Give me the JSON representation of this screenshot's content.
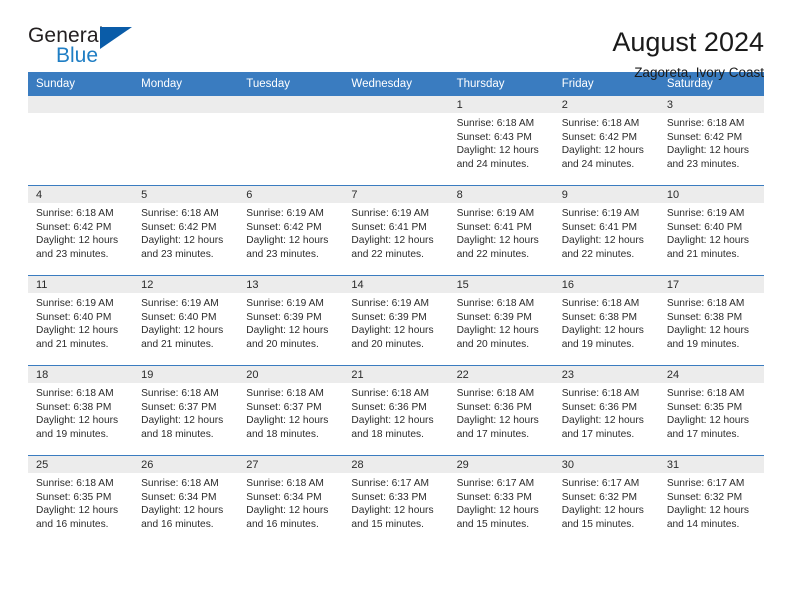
{
  "brand": {
    "line1": "General",
    "line2": "Blue",
    "triangle_color": "#0a5ca8",
    "blue_text_color": "#1f7ec4"
  },
  "header": {
    "title": "August 2024",
    "subtitle": "Zagoreta, Ivory Coast",
    "header_bg_color": "#3a7cc0",
    "daynum_bg_color": "#ececec"
  },
  "weekday_headers": [
    "Sunday",
    "Monday",
    "Tuesday",
    "Wednesday",
    "Thursday",
    "Friday",
    "Saturday"
  ],
  "labels": {
    "sunrise": "Sunrise:",
    "sunset": "Sunset:",
    "daylight": "Daylight:"
  },
  "weeks": [
    [
      {
        "empty": true
      },
      {
        "empty": true
      },
      {
        "empty": true
      },
      {
        "empty": true
      },
      {
        "day": "1",
        "sunrise": "Sunrise: 6:18 AM",
        "sunset": "Sunset: 6:43 PM",
        "daylight1": "Daylight: 12 hours",
        "daylight2": "and 24 minutes."
      },
      {
        "day": "2",
        "sunrise": "Sunrise: 6:18 AM",
        "sunset": "Sunset: 6:42 PM",
        "daylight1": "Daylight: 12 hours",
        "daylight2": "and 24 minutes."
      },
      {
        "day": "3",
        "sunrise": "Sunrise: 6:18 AM",
        "sunset": "Sunset: 6:42 PM",
        "daylight1": "Daylight: 12 hours",
        "daylight2": "and 23 minutes."
      }
    ],
    [
      {
        "day": "4",
        "sunrise": "Sunrise: 6:18 AM",
        "sunset": "Sunset: 6:42 PM",
        "daylight1": "Daylight: 12 hours",
        "daylight2": "and 23 minutes."
      },
      {
        "day": "5",
        "sunrise": "Sunrise: 6:18 AM",
        "sunset": "Sunset: 6:42 PM",
        "daylight1": "Daylight: 12 hours",
        "daylight2": "and 23 minutes."
      },
      {
        "day": "6",
        "sunrise": "Sunrise: 6:19 AM",
        "sunset": "Sunset: 6:42 PM",
        "daylight1": "Daylight: 12 hours",
        "daylight2": "and 23 minutes."
      },
      {
        "day": "7",
        "sunrise": "Sunrise: 6:19 AM",
        "sunset": "Sunset: 6:41 PM",
        "daylight1": "Daylight: 12 hours",
        "daylight2": "and 22 minutes."
      },
      {
        "day": "8",
        "sunrise": "Sunrise: 6:19 AM",
        "sunset": "Sunset: 6:41 PM",
        "daylight1": "Daylight: 12 hours",
        "daylight2": "and 22 minutes."
      },
      {
        "day": "9",
        "sunrise": "Sunrise: 6:19 AM",
        "sunset": "Sunset: 6:41 PM",
        "daylight1": "Daylight: 12 hours",
        "daylight2": "and 22 minutes."
      },
      {
        "day": "10",
        "sunrise": "Sunrise: 6:19 AM",
        "sunset": "Sunset: 6:40 PM",
        "daylight1": "Daylight: 12 hours",
        "daylight2": "and 21 minutes."
      }
    ],
    [
      {
        "day": "11",
        "sunrise": "Sunrise: 6:19 AM",
        "sunset": "Sunset: 6:40 PM",
        "daylight1": "Daylight: 12 hours",
        "daylight2": "and 21 minutes."
      },
      {
        "day": "12",
        "sunrise": "Sunrise: 6:19 AM",
        "sunset": "Sunset: 6:40 PM",
        "daylight1": "Daylight: 12 hours",
        "daylight2": "and 21 minutes."
      },
      {
        "day": "13",
        "sunrise": "Sunrise: 6:19 AM",
        "sunset": "Sunset: 6:39 PM",
        "daylight1": "Daylight: 12 hours",
        "daylight2": "and 20 minutes."
      },
      {
        "day": "14",
        "sunrise": "Sunrise: 6:19 AM",
        "sunset": "Sunset: 6:39 PM",
        "daylight1": "Daylight: 12 hours",
        "daylight2": "and 20 minutes."
      },
      {
        "day": "15",
        "sunrise": "Sunrise: 6:18 AM",
        "sunset": "Sunset: 6:39 PM",
        "daylight1": "Daylight: 12 hours",
        "daylight2": "and 20 minutes."
      },
      {
        "day": "16",
        "sunrise": "Sunrise: 6:18 AM",
        "sunset": "Sunset: 6:38 PM",
        "daylight1": "Daylight: 12 hours",
        "daylight2": "and 19 minutes."
      },
      {
        "day": "17",
        "sunrise": "Sunrise: 6:18 AM",
        "sunset": "Sunset: 6:38 PM",
        "daylight1": "Daylight: 12 hours",
        "daylight2": "and 19 minutes."
      }
    ],
    [
      {
        "day": "18",
        "sunrise": "Sunrise: 6:18 AM",
        "sunset": "Sunset: 6:38 PM",
        "daylight1": "Daylight: 12 hours",
        "daylight2": "and 19 minutes."
      },
      {
        "day": "19",
        "sunrise": "Sunrise: 6:18 AM",
        "sunset": "Sunset: 6:37 PM",
        "daylight1": "Daylight: 12 hours",
        "daylight2": "and 18 minutes."
      },
      {
        "day": "20",
        "sunrise": "Sunrise: 6:18 AM",
        "sunset": "Sunset: 6:37 PM",
        "daylight1": "Daylight: 12 hours",
        "daylight2": "and 18 minutes."
      },
      {
        "day": "21",
        "sunrise": "Sunrise: 6:18 AM",
        "sunset": "Sunset: 6:36 PM",
        "daylight1": "Daylight: 12 hours",
        "daylight2": "and 18 minutes."
      },
      {
        "day": "22",
        "sunrise": "Sunrise: 6:18 AM",
        "sunset": "Sunset: 6:36 PM",
        "daylight1": "Daylight: 12 hours",
        "daylight2": "and 17 minutes."
      },
      {
        "day": "23",
        "sunrise": "Sunrise: 6:18 AM",
        "sunset": "Sunset: 6:36 PM",
        "daylight1": "Daylight: 12 hours",
        "daylight2": "and 17 minutes."
      },
      {
        "day": "24",
        "sunrise": "Sunrise: 6:18 AM",
        "sunset": "Sunset: 6:35 PM",
        "daylight1": "Daylight: 12 hours",
        "daylight2": "and 17 minutes."
      }
    ],
    [
      {
        "day": "25",
        "sunrise": "Sunrise: 6:18 AM",
        "sunset": "Sunset: 6:35 PM",
        "daylight1": "Daylight: 12 hours",
        "daylight2": "and 16 minutes."
      },
      {
        "day": "26",
        "sunrise": "Sunrise: 6:18 AM",
        "sunset": "Sunset: 6:34 PM",
        "daylight1": "Daylight: 12 hours",
        "daylight2": "and 16 minutes."
      },
      {
        "day": "27",
        "sunrise": "Sunrise: 6:18 AM",
        "sunset": "Sunset: 6:34 PM",
        "daylight1": "Daylight: 12 hours",
        "daylight2": "and 16 minutes."
      },
      {
        "day": "28",
        "sunrise": "Sunrise: 6:17 AM",
        "sunset": "Sunset: 6:33 PM",
        "daylight1": "Daylight: 12 hours",
        "daylight2": "and 15 minutes."
      },
      {
        "day": "29",
        "sunrise": "Sunrise: 6:17 AM",
        "sunset": "Sunset: 6:33 PM",
        "daylight1": "Daylight: 12 hours",
        "daylight2": "and 15 minutes."
      },
      {
        "day": "30",
        "sunrise": "Sunrise: 6:17 AM",
        "sunset": "Sunset: 6:32 PM",
        "daylight1": "Daylight: 12 hours",
        "daylight2": "and 15 minutes."
      },
      {
        "day": "31",
        "sunrise": "Sunrise: 6:17 AM",
        "sunset": "Sunset: 6:32 PM",
        "daylight1": "Daylight: 12 hours",
        "daylight2": "and 14 minutes."
      }
    ]
  ]
}
